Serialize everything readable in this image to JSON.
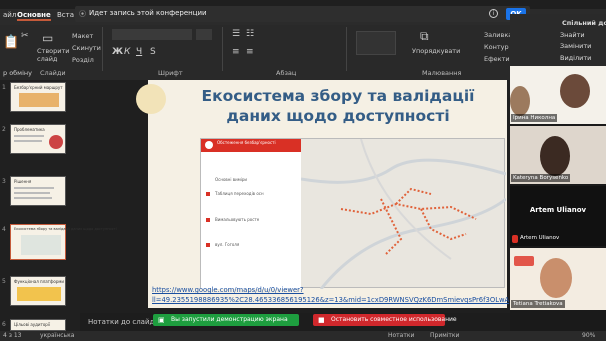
{
  "conference": {
    "title": "Идет запись этой конференции",
    "ok_label": "OK"
  },
  "tabs": [
    "айл",
    "Основне",
    "Вста"
  ],
  "ribbon": {
    "clipboard_label": "р обміну",
    "create_slide": "Створити\nслайд",
    "layout": "Макет",
    "reset": "Скинути",
    "section": "Розділ",
    "slides_group": "Слайди",
    "font_group": "Шрифт",
    "paragraph_group": "Абзац",
    "drawing_group": "Малювання",
    "arrange": "Упорядкувати",
    "shape_fill": "Заливка фігури",
    "shape_outline": "Контур фігури",
    "shape_effects": "Ефекти для фігури",
    "shared_cmd": "Спільний доступ",
    "find": "Знайти",
    "replace": "Замінити",
    "select": "Виділити"
  },
  "thumbnails": [
    {
      "num": "1",
      "title": "Безбар'єрний маршрут"
    },
    {
      "num": "2",
      "title": "Проблематика"
    },
    {
      "num": "3",
      "title": "Рішення"
    },
    {
      "num": "4",
      "title": "Екосистема збору та валідації даних щодо доступності"
    },
    {
      "num": "5",
      "title": "Функціонал платформи"
    },
    {
      "num": "6",
      "title": "Цільові аудиторії"
    }
  ],
  "slide": {
    "title": "Екосистема збору та валідації даних щодо доступності",
    "map_header": "Обстеження безбар'єрності",
    "map_items": [
      "Основні виміри",
      "Таблиця переходів осн",
      "Вимальовують росте",
      "вул. Гоголя"
    ],
    "url": "https://www.google.com/maps/d/u/0/viewer?ll=49.2355198886935%2C28.465336856195126&z=13&mid=1cxD9RWNSVQzK6DmSmievqsPr6f3OLwA"
  },
  "notes_label": "Нотатки до слайда",
  "demo_button": "Вы запустили демонстрацию экрана",
  "stop_button": "Остановить совместное использование",
  "status": {
    "slide": "4 з 13",
    "language": "українська",
    "notes": "Нотатки",
    "comments": "Примітки",
    "zoom": "90%"
  },
  "participants": [
    {
      "name": "Ірина Николна"
    },
    {
      "name": "Kateryna Borysenko"
    },
    {
      "name": "Artem Ulianov"
    },
    {
      "name": "Artem Ulianov"
    },
    {
      "name": "Tetiana Tretiakova"
    }
  ]
}
